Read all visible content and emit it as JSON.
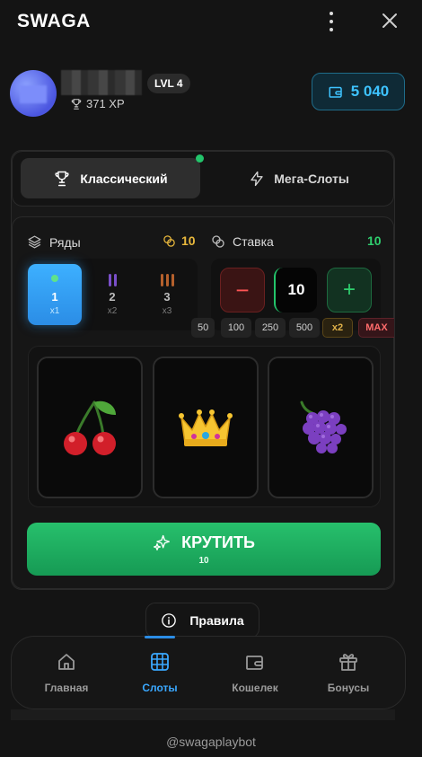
{
  "app": {
    "title": "SWAGA"
  },
  "profile": {
    "level": "LVL 4",
    "xp": "371 XP",
    "balance": "5 040"
  },
  "tabs": [
    {
      "label": "Классический",
      "icon": "trophy-icon",
      "active": true
    },
    {
      "label": "Мега-Слоты",
      "icon": "lightning-icon",
      "active": false
    }
  ],
  "rows": {
    "label": "Ряды",
    "cost": "10",
    "options": [
      {
        "num": "1",
        "mult": "x1",
        "selected": true
      },
      {
        "num": "2",
        "mult": "x2",
        "selected": false
      },
      {
        "num": "3",
        "mult": "x3",
        "selected": false
      }
    ]
  },
  "bet": {
    "label": "Ставка",
    "value_top": "10",
    "value": "10",
    "minus": "−",
    "plus": "+",
    "presets": [
      "50",
      "100",
      "250",
      "500"
    ],
    "double": "x2",
    "max": "MAX"
  },
  "reels": [
    "cherry-icon",
    "crown-icon",
    "grapes-icon"
  ],
  "spin": {
    "label": "КРУТИТЬ",
    "cost": "10"
  },
  "rules": {
    "label": "Правила"
  },
  "nav": [
    {
      "label": "Главная",
      "icon": "home-icon",
      "active": false
    },
    {
      "label": "Слоты",
      "icon": "grid-icon",
      "active": true
    },
    {
      "label": "Кошелек",
      "icon": "wallet-icon",
      "active": false
    },
    {
      "label": "Бонусы",
      "icon": "gift-icon",
      "active": false
    }
  ],
  "footer": {
    "handle": "@swagaplaybot"
  },
  "colors": {
    "accent_blue": "#3aa8ff",
    "accent_green": "#23c46b",
    "gold": "#e9b83c",
    "danger": "#ff5555"
  }
}
